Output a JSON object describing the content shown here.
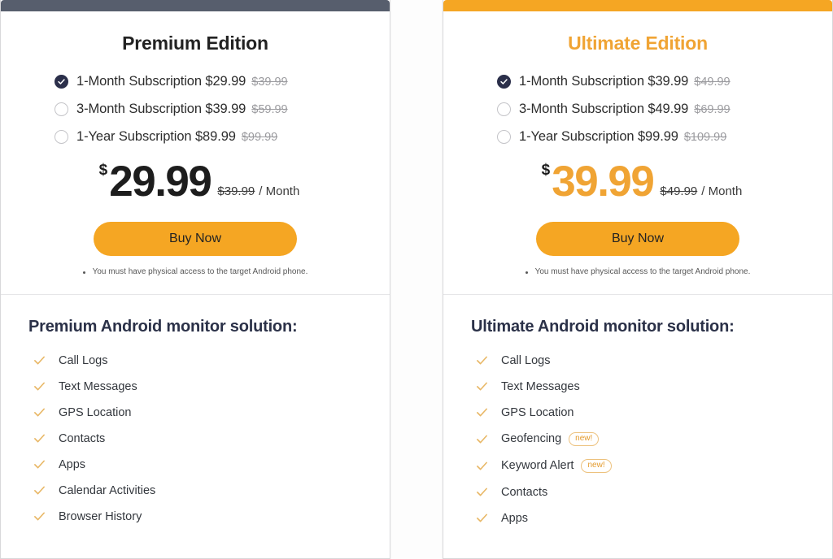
{
  "theme": {
    "orange": "#f5a623",
    "slate": "#575e6d",
    "navy": "#2b2f4a",
    "heading_navy": "#2b3148",
    "muted": "#9b9b9f"
  },
  "cards": [
    {
      "id": "premium",
      "topbar_color": "#575e6d",
      "title": "Premium Edition",
      "title_color": "#222222",
      "price_color": "#1d1d1d",
      "options": [
        {
          "label": "1-Month Subscription $29.99",
          "old_price": "$39.99",
          "selected": true
        },
        {
          "label": "3-Month Subscription $39.99",
          "old_price": "$59.99",
          "selected": false
        },
        {
          "label": "1-Year Subscription $89.99",
          "old_price": "$99.99",
          "selected": false
        }
      ],
      "price": {
        "currency": "$",
        "amount": "29.99",
        "old_amount": "$39.99",
        "period": "/ Month"
      },
      "buy_label": "Buy Now",
      "note": "You must have physical access to the target Android phone.",
      "features_title": "Premium Android monitor solution:",
      "features": [
        {
          "label": "Call Logs",
          "badge": ""
        },
        {
          "label": "Text Messages",
          "badge": ""
        },
        {
          "label": "GPS Location",
          "badge": ""
        },
        {
          "label": "Contacts",
          "badge": ""
        },
        {
          "label": "Apps",
          "badge": ""
        },
        {
          "label": "Calendar Activities",
          "badge": ""
        },
        {
          "label": "Browser History",
          "badge": ""
        }
      ]
    },
    {
      "id": "ultimate",
      "topbar_color": "#f5a623",
      "title": "Ultimate Edition",
      "title_color": "#f0a434",
      "price_color": "#f0a434",
      "options": [
        {
          "label": "1-Month Subscription $39.99",
          "old_price": "$49.99",
          "selected": true
        },
        {
          "label": "3-Month Subscription $49.99",
          "old_price": "$69.99",
          "selected": false
        },
        {
          "label": "1-Year Subscription $99.99",
          "old_price": "$109.99",
          "selected": false
        }
      ],
      "price": {
        "currency": "$",
        "amount": "39.99",
        "old_amount": "$49.99",
        "period": "/ Month"
      },
      "buy_label": "Buy Now",
      "note": "You must have physical access to the target Android phone.",
      "features_title": "Ultimate Android monitor solution:",
      "features": [
        {
          "label": "Call Logs",
          "badge": ""
        },
        {
          "label": "Text Messages",
          "badge": ""
        },
        {
          "label": "GPS Location",
          "badge": ""
        },
        {
          "label": "Geofencing",
          "badge": "new!"
        },
        {
          "label": "Keyword Alert",
          "badge": "new!"
        },
        {
          "label": "Contacts",
          "badge": ""
        },
        {
          "label": "Apps",
          "badge": ""
        }
      ]
    }
  ]
}
